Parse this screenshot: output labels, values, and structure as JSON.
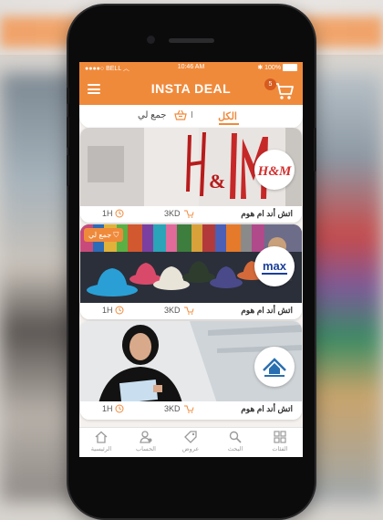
{
  "status_bar": {
    "carrier": "BELL",
    "time": "10:46 AM",
    "battery": "100%"
  },
  "header": {
    "title": "INSTA DEAL",
    "cart_count": "5"
  },
  "filter_tabs": {
    "all": "الكل",
    "separator": "I",
    "collect": "جمع لي"
  },
  "deals": [
    {
      "title": "اتش أند ام هوم",
      "price": "3KD",
      "time": "1H",
      "logo": "H&M",
      "collect_badge": ""
    },
    {
      "title": "اتش أند ام هوم",
      "price": "3KD",
      "time": "1H",
      "logo": "max",
      "collect_badge": "جمع لي"
    },
    {
      "title": "اتش أند ام هوم",
      "price": "3KD",
      "time": "1H",
      "logo": "",
      "collect_badge": ""
    }
  ],
  "tab_bar": [
    {
      "label": "الرئيسية",
      "icon": "home-icon"
    },
    {
      "label": "الحساب",
      "icon": "account-icon"
    },
    {
      "label": "عروض",
      "icon": "tag-icon"
    },
    {
      "label": "البحث",
      "icon": "search-icon"
    },
    {
      "label": "الفئات",
      "icon": "categories-icon"
    }
  ],
  "colors": {
    "accent": "#f08a3b",
    "background": "#f4f1ee"
  }
}
